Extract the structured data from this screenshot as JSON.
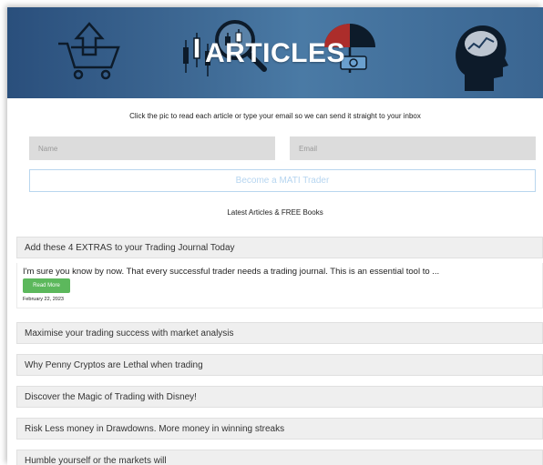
{
  "hero": {
    "title": "ARTICLES",
    "icons": [
      "cart-up-arrow-icon",
      "candlestick-chart-icon",
      "magnifier-icon",
      "umbrella-money-icon",
      "brain-chart-icon"
    ],
    "background": "#3e6994"
  },
  "intro_text": "Click the pic to read each article or type your email so we can send it straight to your inbox",
  "form": {
    "name_placeholder": "Name",
    "email_placeholder": "Email",
    "submit_label": "Become a MATI Trader"
  },
  "latest_heading": "Latest Articles & FREE Books",
  "featured": {
    "title": "Add these 4 EXTRAS to your Trading Journal Today",
    "excerpt": "I'm sure you know by now. That every successful trader needs a trading journal. This is an essential tool to ...",
    "read_more": "Read More",
    "date": "February 22, 2023"
  },
  "articles": [
    {
      "title": "Maximise your trading success with market analysis"
    },
    {
      "title": "Why Penny Cryptos are Lethal when trading"
    },
    {
      "title": "Discover the Magic of Trading with Disney!"
    },
    {
      "title": "Risk Less money in Drawdowns. More money in winning streaks"
    },
    {
      "title": "Humble yourself or the markets will"
    }
  ],
  "colors": {
    "accent_green": "#5cb85c",
    "cta_border": "#b9d6ee",
    "cta_text": "#b6d5f0"
  }
}
